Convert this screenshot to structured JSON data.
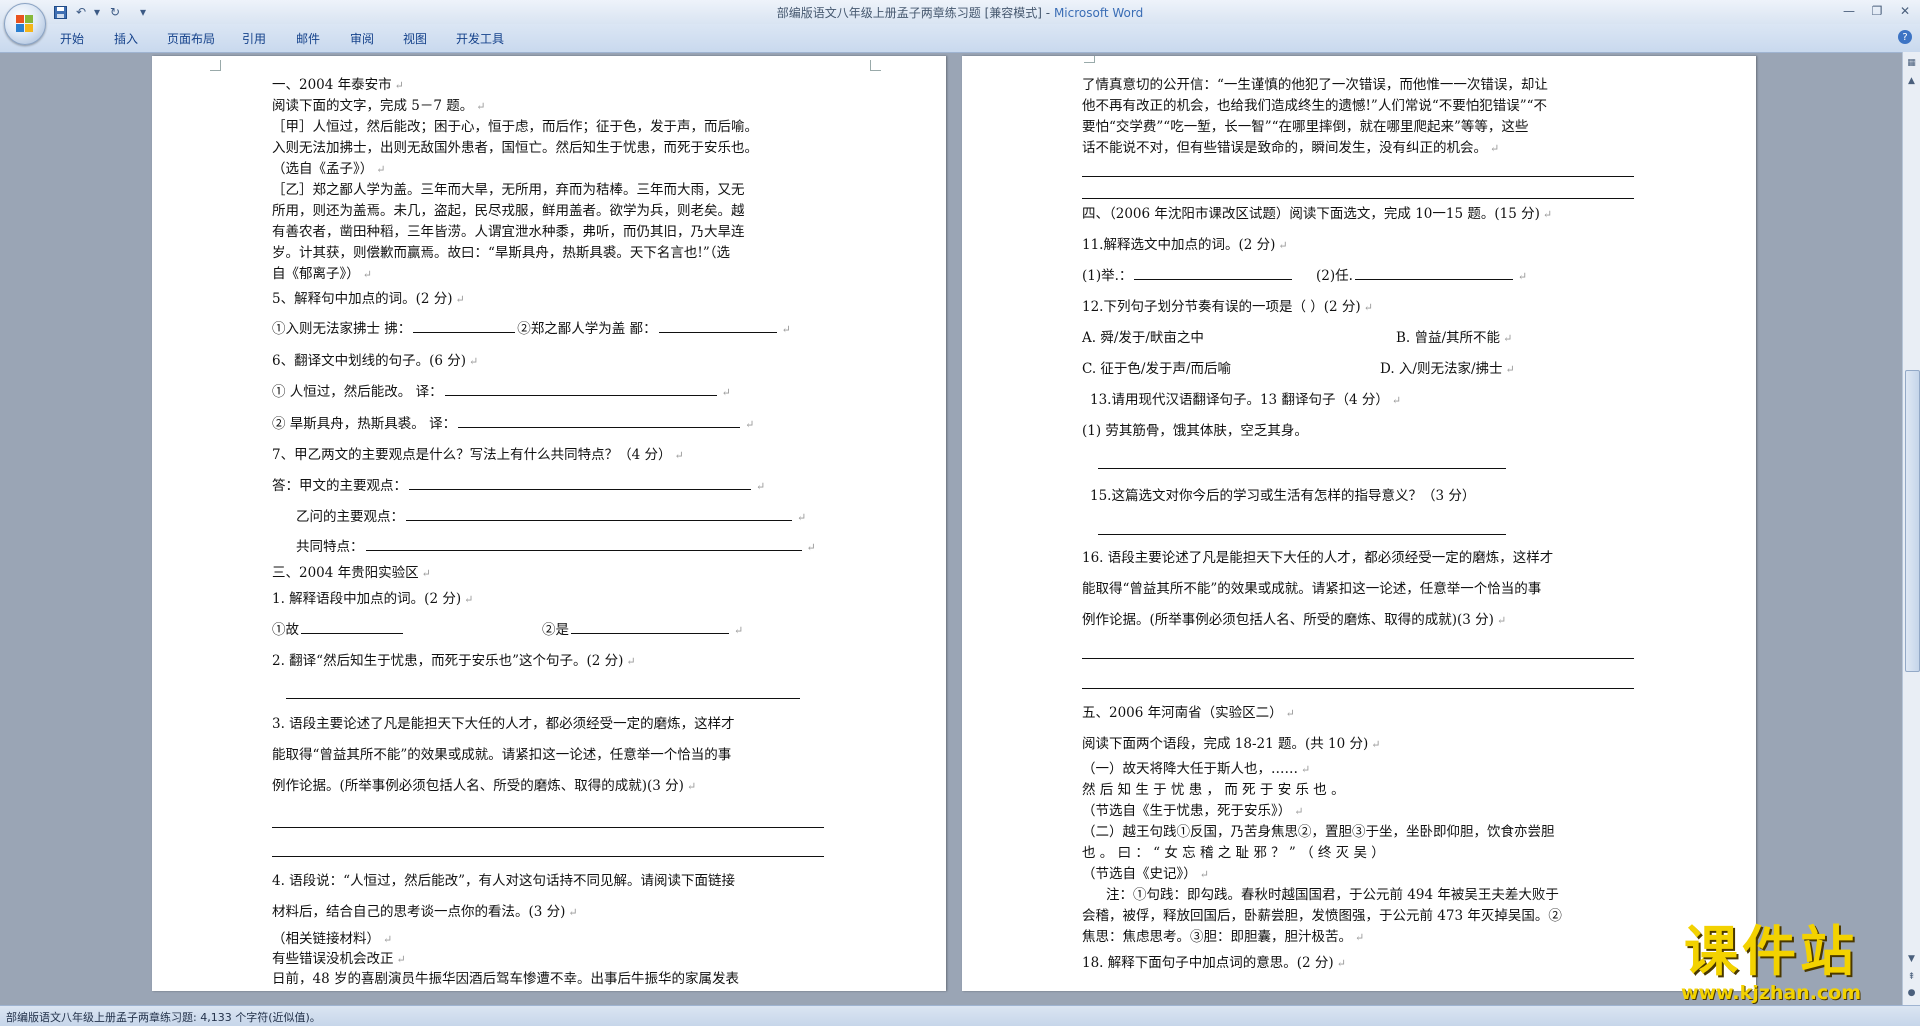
{
  "window": {
    "doc_title": "部编版语文八年级上册孟子两章练习题 [兼容模式]",
    "app_name": "Microsoft Word",
    "separator": " - "
  },
  "ribbon": {
    "tabs": [
      "开始",
      "插入",
      "页面布局",
      "引用",
      "邮件",
      "审阅",
      "视图",
      "开发工具"
    ]
  },
  "status": {
    "text": "部编版语文八年级上册孟子两章练习题: 4,133 个字符(近似值)。"
  },
  "watermark": {
    "title": "课件站",
    "url": "www.kjzhan.com"
  },
  "page_left": {
    "lines": [
      "一、2004 年泰安市",
      "阅读下面的文字，完成 5－7 题。",
      "［甲］人恒过，然后能改；困于心，恒于虑，而后作；征于色，发于声，而后喻。",
      "入则无法加拂士，出则无敌国外患者，国恒亡。然后知生于忧患，而死于安乐也。",
      "（选自《孟子》）",
      "［乙］郑之鄙人学为盖。三年而大旱，无所用，弃而为秸棒。三年而大雨，又无",
      "所用，则还为盖焉。未几，盗起，民尽戎服，鲜用盖者。欲学为兵，则老矣。越",
      "有善农者，凿田种稻，三年皆涝。人谓宜泄水种黍，弗听，而仍其旧，乃大旱连",
      "岁。计其获，则偿歉而赢焉。故曰：“旱斯具舟，热斯具裘。天下名言也!”（选",
      "自《郁离子》）",
      "5、解释句中加点的词。(2 分)",
      "①入则无法家拂士  拂：",
      "②郑之鄙人学为盖  鄙：",
      "6、翻译文中划线的句子。(6 分)",
      "① 人恒过，然后能改。  译：",
      "② 旱斯具舟，热斯具裘。  译：",
      "7、甲乙两文的主要观点是什么？写法上有什么共同特点？（4 分）",
      "答：甲文的主要观点：",
      "乙问的主要观点：",
      "共同特点：",
      "三、2004 年贵阳实验区",
      "1. 解释语段中加点的词。(2 分)",
      "①故",
      "②是",
      "2. 翻译“然后知生于忧患，而死于安乐也”这个句子。(2 分)",
      "3. 语段主要论述了凡是能担天下大任的人才，都必须经受一定的磨炼，这样才",
      "能取得“曾益其所不能”的效果或成就。请紧扣这一论述，任意举一个恰当的事",
      "例作论据。(所举事例必须包括人名、所受的磨炼、取得的成就)(3 分)",
      "4. 语段说：“人恒过，然后能改”，有人对这句话持不同见解。请阅读下面链接",
      "材料后，结合自己的思考谈一点你的看法。(3 分)",
      "（相关链接材料）",
      "有些错误没机会改正",
      "日前，48 岁的喜剧演员牛振华因酒后驾车惨遭不幸。出事后牛振华的家属发表"
    ]
  },
  "page_right": {
    "lines": [
      "了情真意切的公开信：“一生谨慎的他犯了一次错误，而他惟一一次错误，却让",
      "他不再有改正的机会，也给我们造成终生的遗憾!”人们常说“不要怕犯错误”“不",
      "要怕“交学费”“吃一堑，长一智”“在哪里摔倒，就在哪里爬起来”等等，这些",
      "话不能说不对，但有些错误是致命的，瞬间发生，没有纠正的机会。",
      "四、（2006 年沈阳市课改区试题）阅读下面选文，完成 10一15 题。(15 分)",
      "11.解释选文中加点的词。(2 分)",
      "(1)举.：",
      "(2)任.",
      "12.下列句子划分节奏有误的一项是（        ）(2 分)",
      "A. 舜/发于/畎亩之中",
      "B. 曾益/其所不能",
      "C. 征于色/发于声/而后喻",
      "D. 入/则无法家/拂士",
      "13.请用现代汉语翻译句子。13 翻译句子（4 分）",
      "(1) 劳其筋骨，饿其体肤，空乏其身。",
      "15.这篇选文对你今后的学习或生活有怎样的指导意义？（3 分）",
      "16. 语段主要论述了凡是能担天下大任的人才，都必须经受一定的磨炼，这样才",
      "能取得“曾益其所不能”的效果或成就。请紧扣这一论述，任意举一个恰当的事",
      "例作论据。(所举事例必须包括人名、所受的磨炼、取得的成就)(3 分)",
      "五、2006 年河南省（实验区二）",
      "阅读下面两个语段，完成 18-21 题。(共 10 分)",
      "（一）故天将降大任于斯人也，……",
      "然 后 知 生 于 忧 患 ， 而 死 于 安 乐 也 。",
      "（节选自《生于忧患，死于安乐》）",
      "（二）越王句践①反国，乃苦身焦思②，置胆③于坐，坐卧即仰胆，饮食亦尝胆",
      "也 。 曰 ： “ 女 忘 稽 之 耻 邪 ？ ” （ 终 灭 吴 ）",
      "（节选自《史记》）",
      "注：①句践：即勾践。春秋时越国国君，于公元前 494 年被吴王夫差大败于",
      "会稽，被俘，释放回国后，卧薪尝胆，发愤图强，于公元前 473 年灭掉吴国。②",
      "焦思：焦虑思考。③胆：即胆囊，胆汁极苦。",
      "18. 解释下面句子中加点词的意思。(2 分)"
    ]
  }
}
